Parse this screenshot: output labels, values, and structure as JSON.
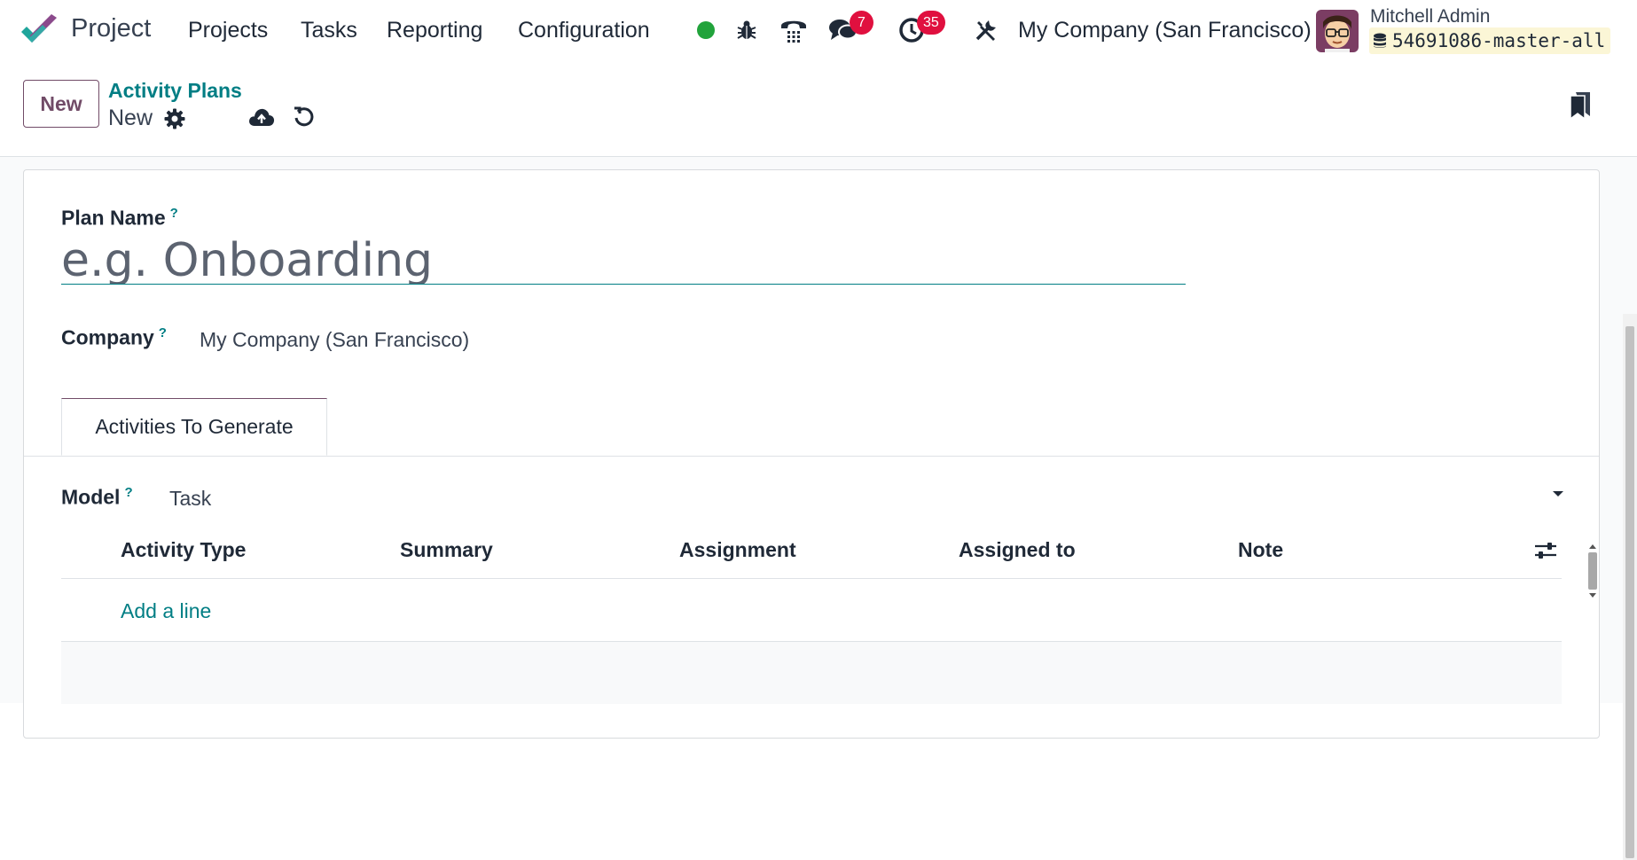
{
  "nav": {
    "app_name": "Project",
    "menu": [
      "Projects",
      "Tasks",
      "Reporting",
      "Configuration"
    ],
    "messages_count": "7",
    "activities_count": "35",
    "company": "My Company (San Francisco)",
    "user_name": "Mitchell Admin",
    "database": "54691086-master-all",
    "status_color": "#21a33b"
  },
  "control": {
    "new_button": "New",
    "breadcrumb_parent": "Activity Plans",
    "breadcrumb_current": "New"
  },
  "form": {
    "plan_name_label": "Plan Name",
    "plan_name_placeholder": "e.g. Onboarding",
    "plan_name_value": "",
    "help_mark": "?",
    "company_label": "Company",
    "company_value": "My Company (San Francisco)",
    "tab_activities": "Activities To Generate",
    "model_label": "Model",
    "model_value": "Task",
    "columns": [
      "Activity Type",
      "Summary",
      "Assignment",
      "Assigned to",
      "Note"
    ],
    "add_line": "Add a line"
  },
  "colors": {
    "brand_purple": "#714b67",
    "accent_teal": "#017e84",
    "badge_red": "#e0103f"
  }
}
